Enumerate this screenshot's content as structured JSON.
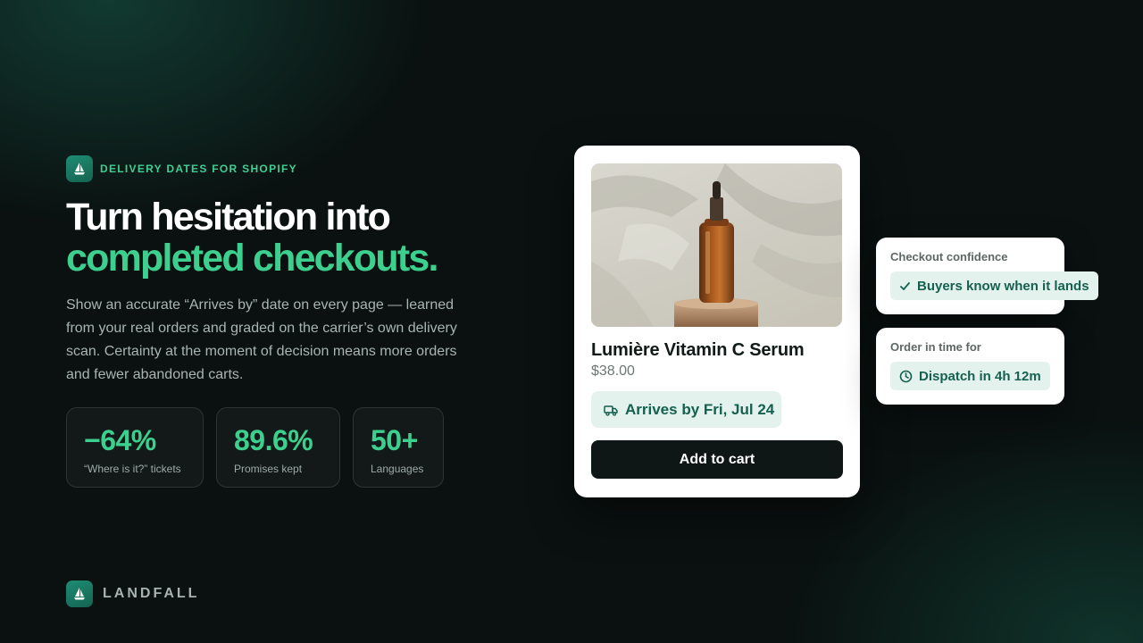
{
  "hero": {
    "eyebrow": "DELIVERY DATES FOR SHOPIFY",
    "headline_line1": "Turn hesitation into",
    "headline_line2": "completed checkouts.",
    "lede": "Show an accurate “Arrives by” date on every page — learned from your real orders and graded on the carrier’s own delivery scan. Certainty at the moment of decision means more orders and fewer abandoned carts."
  },
  "stats": [
    {
      "value": "−64%",
      "label": "“Where is it?” tickets"
    },
    {
      "value": "89.6%",
      "label": "Promises kept"
    },
    {
      "value": "50+",
      "label": "Languages"
    }
  ],
  "brand": {
    "name": "LANDFALL",
    "icon": "sailboat-icon"
  },
  "product": {
    "title": "Lumière Vitamin C Serum",
    "price": "$38.00",
    "arrives": "Arrives by Fri, Jul 24",
    "arrives_icon": "truck-icon",
    "cta": "Add to cart"
  },
  "badges": {
    "confidence": {
      "title": "Checkout confidence",
      "text": "Buyers know when it lands",
      "icon": "check-icon"
    },
    "dispatch": {
      "title": "Order in time for",
      "text": "Dispatch in 4h 12m",
      "icon": "clock-icon"
    }
  },
  "colors": {
    "accent": "#3ccf8e",
    "background": "#0a1110",
    "pill_bg": "#e4f2ee",
    "pill_text": "#15604e",
    "cta_bg": "#0f1716"
  }
}
